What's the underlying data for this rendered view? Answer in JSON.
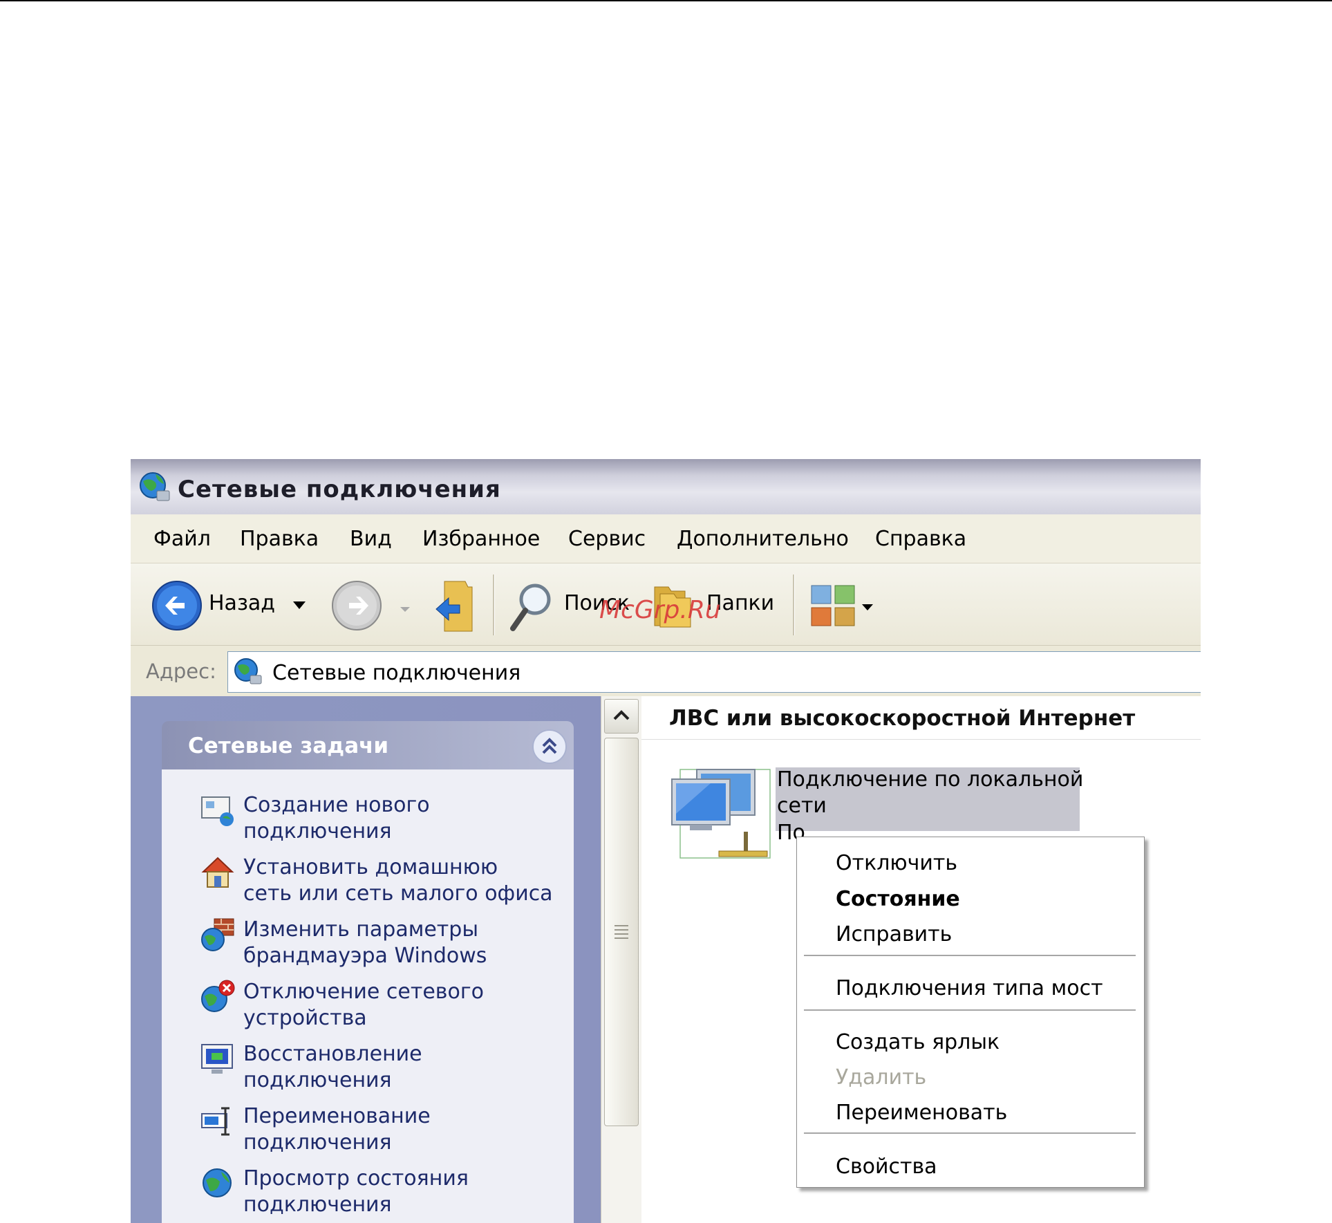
{
  "window": {
    "title": "Сетевые подключения"
  },
  "menu": {
    "items": [
      "Файл",
      "Правка",
      "Вид",
      "Избранное",
      "Сервис",
      "Дополнительно",
      "Справка"
    ]
  },
  "toolbar": {
    "back_label": "Назад",
    "search_label": "Поиск",
    "folders_label": "Папки"
  },
  "address": {
    "label": "Адрес:",
    "value": "Сетевые подключения"
  },
  "tasks": {
    "header": "Сетевые задачи",
    "items": [
      {
        "icon": "new-connection-icon",
        "lines": [
          "Создание нового",
          "подключения"
        ]
      },
      {
        "icon": "home-network-icon",
        "lines": [
          "Установить домашнюю",
          "сеть или сеть малого офиса"
        ]
      },
      {
        "icon": "firewall-icon",
        "lines": [
          "Изменить параметры",
          "брандмауэра Windows"
        ]
      },
      {
        "icon": "disable-device-icon",
        "lines": [
          "Отключение сетевого",
          "устройства"
        ]
      },
      {
        "icon": "repair-connection-icon",
        "lines": [
          "Восстановление",
          "подключения"
        ]
      },
      {
        "icon": "rename-connection-icon",
        "lines": [
          "Переименование",
          "подключения"
        ]
      },
      {
        "icon": "status-connection-icon",
        "lines": [
          "Просмотр состояния",
          "подключения"
        ]
      }
    ]
  },
  "content": {
    "group_title": "ЛВС или высокоскоростной Интернет",
    "connection": {
      "lines": [
        "Подключение по локальной",
        "сети",
        "По"
      ]
    }
  },
  "context_menu": {
    "items": [
      "Отключить",
      "Состояние",
      "Исправить",
      "Подключения типа мост",
      "Создать ярлык",
      "Удалить",
      "Переименовать",
      "Свойства"
    ]
  },
  "watermark": "McGrp.Ru",
  "colors": {
    "title_gradient": "#cfcfdc",
    "task_pane": "#8e98c2",
    "task_text": "#1d2a6a",
    "selection": "#c6c6cf",
    "watermark": "#d83a3a"
  }
}
